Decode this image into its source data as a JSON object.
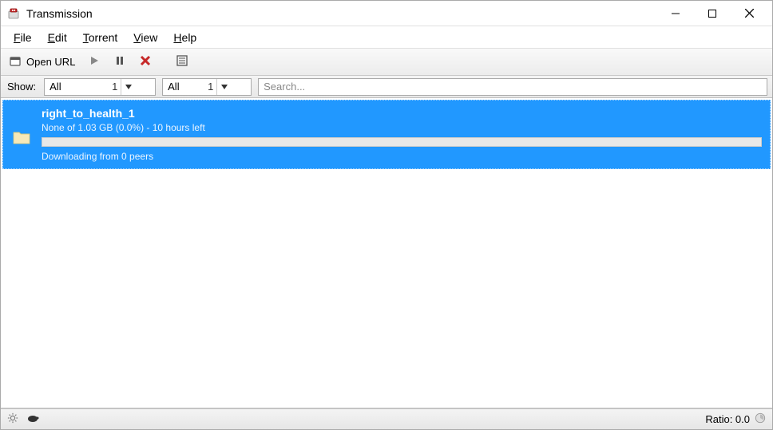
{
  "window": {
    "title": "Transmission"
  },
  "menu": {
    "items": [
      "File",
      "Edit",
      "Torrent",
      "View",
      "Help"
    ]
  },
  "toolbar": {
    "open_url": "Open URL"
  },
  "filter": {
    "label": "Show:",
    "combo1": {
      "text": "All",
      "count": "1"
    },
    "combo2": {
      "text": "All",
      "count": "1"
    },
    "search_placeholder": "Search..."
  },
  "torrents": [
    {
      "name": "right_to_health_1",
      "status": "None of 1.03 GB (0.0%) - 10 hours left",
      "progress_percent": 0,
      "peers": "Downloading from 0 peers"
    }
  ],
  "statusbar": {
    "ratio_label": "Ratio: 0.0"
  }
}
